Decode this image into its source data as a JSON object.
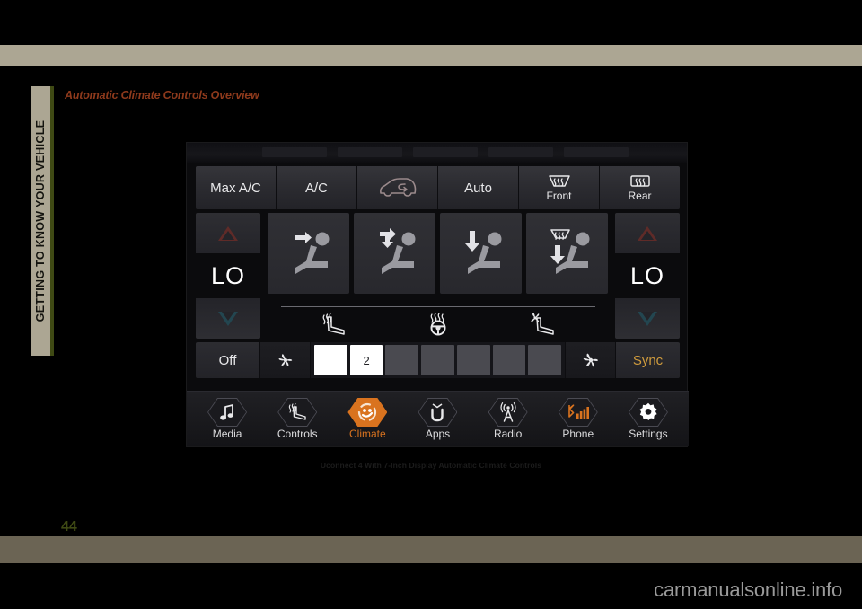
{
  "page": {
    "chapter_tab": "GETTING TO KNOW YOUR VEHICLE",
    "heading": "Automatic Climate Controls Overview",
    "figure_caption": "Uconnect 4 With 7-Inch Display Automatic Climate Controls",
    "page_number": "44",
    "watermark": "carmanualsonline.info",
    "colors": {
      "band_top": "#aca693",
      "band_bottom": "#6b6454",
      "tab_green": "#3f4a14",
      "heading_red": "#8f3a1c",
      "accent_orange": "#d9731f",
      "sync_gold": "#cf9b3d",
      "temp_up_red": "#5f2b28",
      "temp_down_blue": "#234650"
    }
  },
  "uconnect": {
    "top_row": [
      {
        "label": "Max A/C",
        "icon": "",
        "sub": ""
      },
      {
        "label": "A/C",
        "icon": "",
        "sub": ""
      },
      {
        "label": "",
        "icon": "recirculation-icon",
        "sub": ""
      },
      {
        "label": "Auto",
        "icon": "",
        "sub": ""
      },
      {
        "label": "",
        "icon": "front-defrost-icon",
        "sub": "Front"
      },
      {
        "label": "",
        "icon": "rear-defrost-icon",
        "sub": "Rear"
      }
    ],
    "temperature": {
      "left": {
        "value": "LO",
        "up_icon": "triangle-up-icon",
        "down_icon": "triangle-down-icon"
      },
      "right": {
        "value": "LO",
        "up_icon": "triangle-up-icon",
        "down_icon": "triangle-down-icon"
      }
    },
    "airflow_modes": [
      {
        "name": "mode-face-icon"
      },
      {
        "name": "mode-face-floor-icon"
      },
      {
        "name": "mode-floor-icon"
      },
      {
        "name": "mode-floor-defrost-icon"
      }
    ],
    "comfort_buttons": [
      {
        "name": "heated-seat-icon"
      },
      {
        "name": "heated-steering-wheel-icon"
      },
      {
        "name": "ventilated-seat-icon"
      }
    ],
    "fan_row": {
      "off_label": "Off",
      "sync_label": "Sync",
      "fan_low_icon": "fan-icon",
      "fan_high_icon": "fan-icon",
      "level": 2,
      "segments": 8,
      "level_label": "2"
    },
    "nav": [
      {
        "label": "Media",
        "icon": "music-note-icon",
        "active": false
      },
      {
        "label": "Controls",
        "icon": "controls-icon",
        "active": false
      },
      {
        "label": "Climate",
        "icon": "climate-icon",
        "active": true
      },
      {
        "label": "Apps",
        "icon": "apps-icon",
        "active": false
      },
      {
        "label": "Radio",
        "icon": "radio-tower-icon",
        "active": false
      },
      {
        "label": "Phone",
        "icon": "phone-signal-icon",
        "active": false
      },
      {
        "label": "Settings",
        "icon": "gear-icon",
        "active": false
      }
    ]
  }
}
